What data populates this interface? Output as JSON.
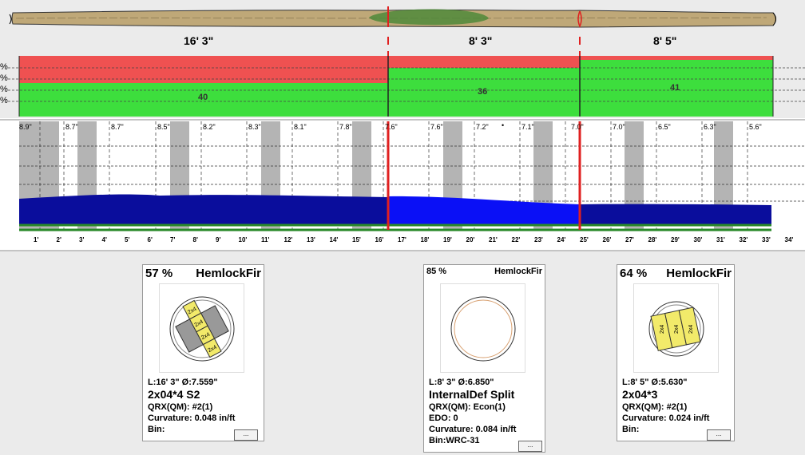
{
  "log": {
    "segment_lengths": [
      "16' 3\"",
      "8' 3\"",
      "8' 5\""
    ]
  },
  "grade_strip": {
    "left_marks": [
      "%",
      "%",
      "%",
      "%"
    ],
    "values": [
      "40",
      "36",
      "41"
    ]
  },
  "diameter_strip": {
    "diameters": [
      "8.9\"",
      "8.7\"",
      "8.7\"",
      "8.5\"",
      "8.2\"",
      "8.3\"",
      "8.1\"",
      "7.8\"",
      "7.6\"",
      "7.6\"",
      "7.2\"",
      "7.1\"",
      "7.0\"",
      "7.0\"",
      "6.5\"",
      "6.3\"",
      "5.6\""
    ],
    "dot": "•",
    "foot_ticks": [
      "1'",
      "2'",
      "3'",
      "4'",
      "5'",
      "6'",
      "7'",
      "8'",
      "9'",
      "10'",
      "11'",
      "12'",
      "13'",
      "14'",
      "15'",
      "16'",
      "17'",
      "18'",
      "19'",
      "20'",
      "21'",
      "22'",
      "23'",
      "24'",
      "25'",
      "26'",
      "27'",
      "28'",
      "29'",
      "30'",
      "31'",
      "32'",
      "33'",
      "34'"
    ]
  },
  "cards": [
    {
      "percent": "57 %",
      "species": "HemlockFir",
      "length_dia": "L:16' 3\" Ø:7.559\"",
      "product": "2x04*4 S2",
      "qrx": "QRX(QM): #2(1)",
      "curvature": "Curvature: 0.048 in/ft",
      "bin": "Bin:",
      "bin_button": "...",
      "board_label": "2x4"
    },
    {
      "percent": "85 %",
      "species": "HemlockFir",
      "length_dia": "L:8' 3\" Ø:6.850\"",
      "product": "InternalDef Split",
      "qrx": "QRX(QM): Econ(1)",
      "edo": "EDO: 0",
      "curvature": "Curvature: 0.084 in/ft",
      "bin": "Bin:WRC-31",
      "bin_button": "..."
    },
    {
      "percent": "64 %",
      "species": "HemlockFir",
      "length_dia": "L:8' 5\" Ø:5.630\"",
      "product": "2x04*3",
      "qrx": "QRX(QM): #2(1)",
      "curvature": "Curvature: 0.024 in/ft",
      "bin": "Bin:",
      "bin_button": "...",
      "board_label": "2x4"
    }
  ],
  "colors": {
    "log_bark": "#bfa878",
    "defect": "#4f8a3a",
    "grade_red": "#ef5151",
    "grade_green": "#3dde3d",
    "profile_blue": "#0a0d9c",
    "profile_light_blue": "#0a10f6",
    "cut_red": "#e02020",
    "board_yellow": "#f2ea6a"
  }
}
